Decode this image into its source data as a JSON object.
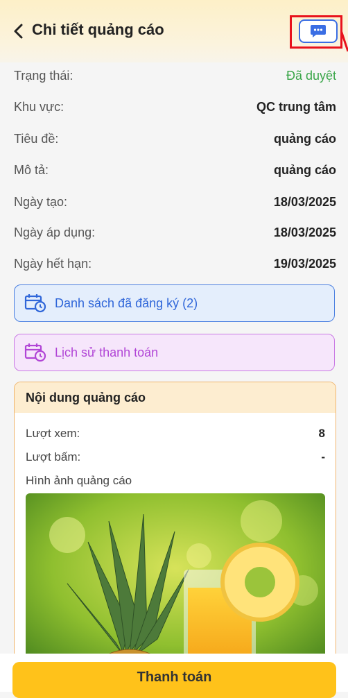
{
  "header": {
    "title": "Chi tiết quảng cáo",
    "back_icon": "chevron-left-icon",
    "chat_icon": "chat-bubble-icon"
  },
  "info": [
    {
      "label": "Trạng thái:",
      "value": "Đã duyệt",
      "status": "approved"
    },
    {
      "label": "Khu vực:",
      "value": "QC trung tâm"
    },
    {
      "label": "Tiêu đề:",
      "value": "quảng cáo"
    },
    {
      "label": "Mô tả:",
      "value": "quảng cáo"
    },
    {
      "label": "Ngày tạo:",
      "value": "18/03/2025"
    },
    {
      "label": "Ngày áp dụng:",
      "value": "18/03/2025"
    },
    {
      "label": "Ngày hết hạn:",
      "value": "19/03/2025"
    }
  ],
  "links": {
    "registered": {
      "label": "Danh sách đã đăng ký (2)",
      "icon": "calendar-clock-icon",
      "color": "#2f66d9"
    },
    "payment_history": {
      "label": "Lịch sử thanh toán",
      "icon": "calendar-clock-icon",
      "color": "#b145d6"
    }
  },
  "content": {
    "title": "Nội dung quảng cáo",
    "views_label": "Lượt xem:",
    "views_value": "8",
    "clicks_label": "Lượt bấm:",
    "clicks_value": "-",
    "image_label": "Hình ảnh quảng cáo"
  },
  "pay_button": {
    "label": "Thanh toán"
  },
  "colors": {
    "accent": "#ffc21a",
    "status_ok": "#3aa649",
    "highlight": "#e8121c"
  }
}
